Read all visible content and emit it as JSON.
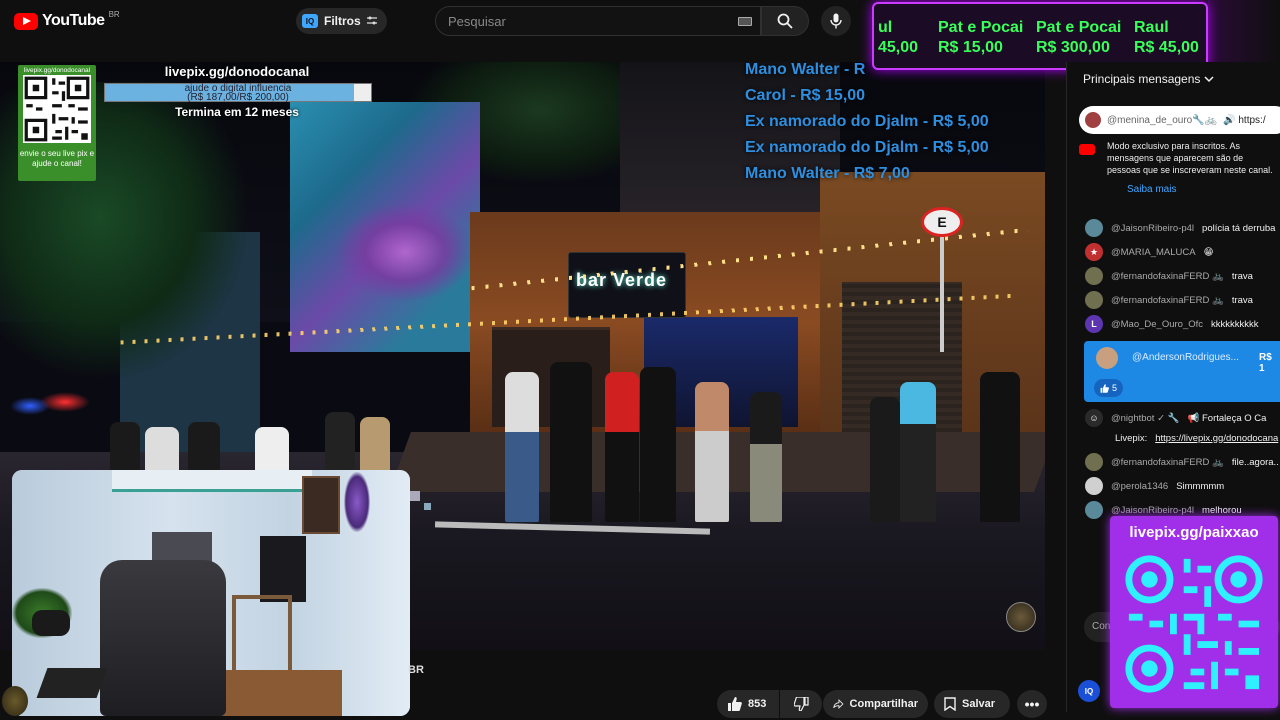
{
  "header": {
    "logo_text": "YouTube",
    "logo_region": "BR",
    "filter_label": "Filtros",
    "iq_label": "IQ",
    "search_placeholder": "Pesquisar"
  },
  "donation_banner": [
    {
      "name": "ul",
      "amount": "45,00"
    },
    {
      "name": "Pat e Pocai",
      "amount": "R$ 15,00"
    },
    {
      "name": "Pat e Pocai",
      "amount": "R$ 300,00"
    },
    {
      "name": "Raul",
      "amount": "R$ 45,00"
    }
  ],
  "livepix_left": {
    "qr_url": "livepix.gg/donodocanal",
    "caption": "envie o seu live pix e ajude o canal!",
    "goal_url": "livepix.gg/donodocanal",
    "goal_desc": "ajude o digital influencia",
    "goal_amount": "(R$ 187,00/R$ 200,00)",
    "goal_fraction": 0.935,
    "goal_end": "Termina em 12 meses"
  },
  "recent_donors": [
    "Mano Walter - R",
    "Carol - R$ 15,00",
    "Ex namorado do Djalm - R$ 5,00",
    "Ex namorado do Djalm - R$ 5,00",
    "Mano Walter - R$ 7,00"
  ],
  "video": {
    "sign_text": "bar Verde",
    "no_parking": "E",
    "title_fragment": "BR"
  },
  "actions": {
    "like_count": "853",
    "share_label": "Compartilhar",
    "save_label": "Salvar",
    "more_label": "•••"
  },
  "chat": {
    "header": "Principais mensagens",
    "pinned_author": "@menina_de_ouro🔧🚲",
    "pinned_text": "🔊 https:/",
    "member_notice": "Modo exclusivo para inscritos. As mensagens que aparecem são de pessoas que se inscreveram neste canal.",
    "member_link": "Saiba mais",
    "messages": [
      {
        "author": "@JaisonRibeiro-p4l",
        "text": "polícia tá derruba",
        "color": "#5a8a9a",
        "initial": ""
      },
      {
        "author": "@MARIA_MALUCA",
        "text": "😁",
        "color": "#c03030",
        "initial": "★"
      },
      {
        "author": "@fernandofaxinaFERD 🚲",
        "text": "trava",
        "color": "#707050",
        "initial": ""
      },
      {
        "author": "@fernandofaxinaFERD 🚲",
        "text": "trava",
        "color": "#707050",
        "initial": ""
      },
      {
        "author": "@Mao_De_Ouro_Ofc",
        "text": "kkkkkkkkkk",
        "color": "#5e35b1",
        "initial": "L"
      }
    ],
    "superchat": {
      "author": "@AndersonRodrigues...",
      "amount": "R$ 1",
      "likes": "5"
    },
    "messages2": [
      {
        "author": "@nightbot ✓ 🔧",
        "text": "📢 Fortaleça O Ca",
        "color": "#2a2a2a",
        "initial": "☺"
      },
      {
        "author": "Livepix:",
        "text": "https://livepix.gg/donodocana",
        "color": "",
        "initial": ""
      },
      {
        "author": "@fernandofaxinaFERD 🚲",
        "text": "file..agora..",
        "color": "#707050",
        "initial": ""
      },
      {
        "author": "@perola1346",
        "text": "Simmmmm",
        "color": "#d0d0d0",
        "initial": ""
      },
      {
        "author": "@JaisonRibeiro-p4l",
        "text": "melhorou",
        "color": "#5a8a9a",
        "initial": ""
      }
    ],
    "input_placeholder": "Con"
  },
  "livepix_right": {
    "url": "livepix.gg/paixxao"
  }
}
